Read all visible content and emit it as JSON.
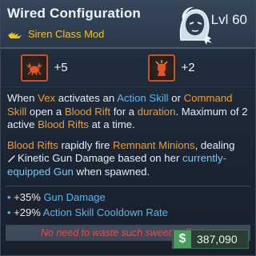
{
  "header": {
    "title": "Wired Configuration",
    "subtitle": "Siren Class Mod",
    "level": "Lvl 60",
    "rarity_icon": "rarity-wings-icon",
    "portrait_icon": "vex-portrait-icon"
  },
  "stats": [
    {
      "icon": "crab-skill-icon",
      "value": "+5"
    },
    {
      "icon": "fist-skill-icon",
      "value": "+2"
    }
  ],
  "description": {
    "p1": {
      "t1": "When ",
      "vex": "Vex",
      "t2": " activates an ",
      "action_skill": "Action Skill",
      "t3": " or ",
      "command_skill": "Command Skill",
      "t4": " open a ",
      "blood_rift": "Blood Rift",
      "t5": " for a ",
      "duration": "duration",
      "t6": ". Maximum of 2 active ",
      "blood_rifts": "Blood Rifts",
      "t7": " at a time."
    },
    "p2": {
      "blood_rifts": "Blood Rifts",
      "t1": " rapidly fire ",
      "remnant_minions": "Remnant Minions",
      "t2": ", dealing",
      "kinetic": "Kinetic Gun Damage",
      "t3": " based on her ",
      "equipped_gun": "currently-equipped Gun",
      "t4": " when spawned."
    }
  },
  "bonuses": [
    {
      "bullet": "•",
      "value": "+35%",
      "label": "Gun Damage"
    },
    {
      "bullet": "•",
      "value": "+29%",
      "label": "Action Skill Cooldown Rate"
    }
  ],
  "flavor_text": "No need to waste such sweet suffering.",
  "price": {
    "symbol": "$",
    "value": "387,090"
  },
  "colors": {
    "accent_blue": "#5fb3ea",
    "accent_orange": "#f39a2b",
    "rarity_yellow": "#f3c21d",
    "flavor_red": "#e84a4a",
    "money_green": "#4a9b5e"
  }
}
